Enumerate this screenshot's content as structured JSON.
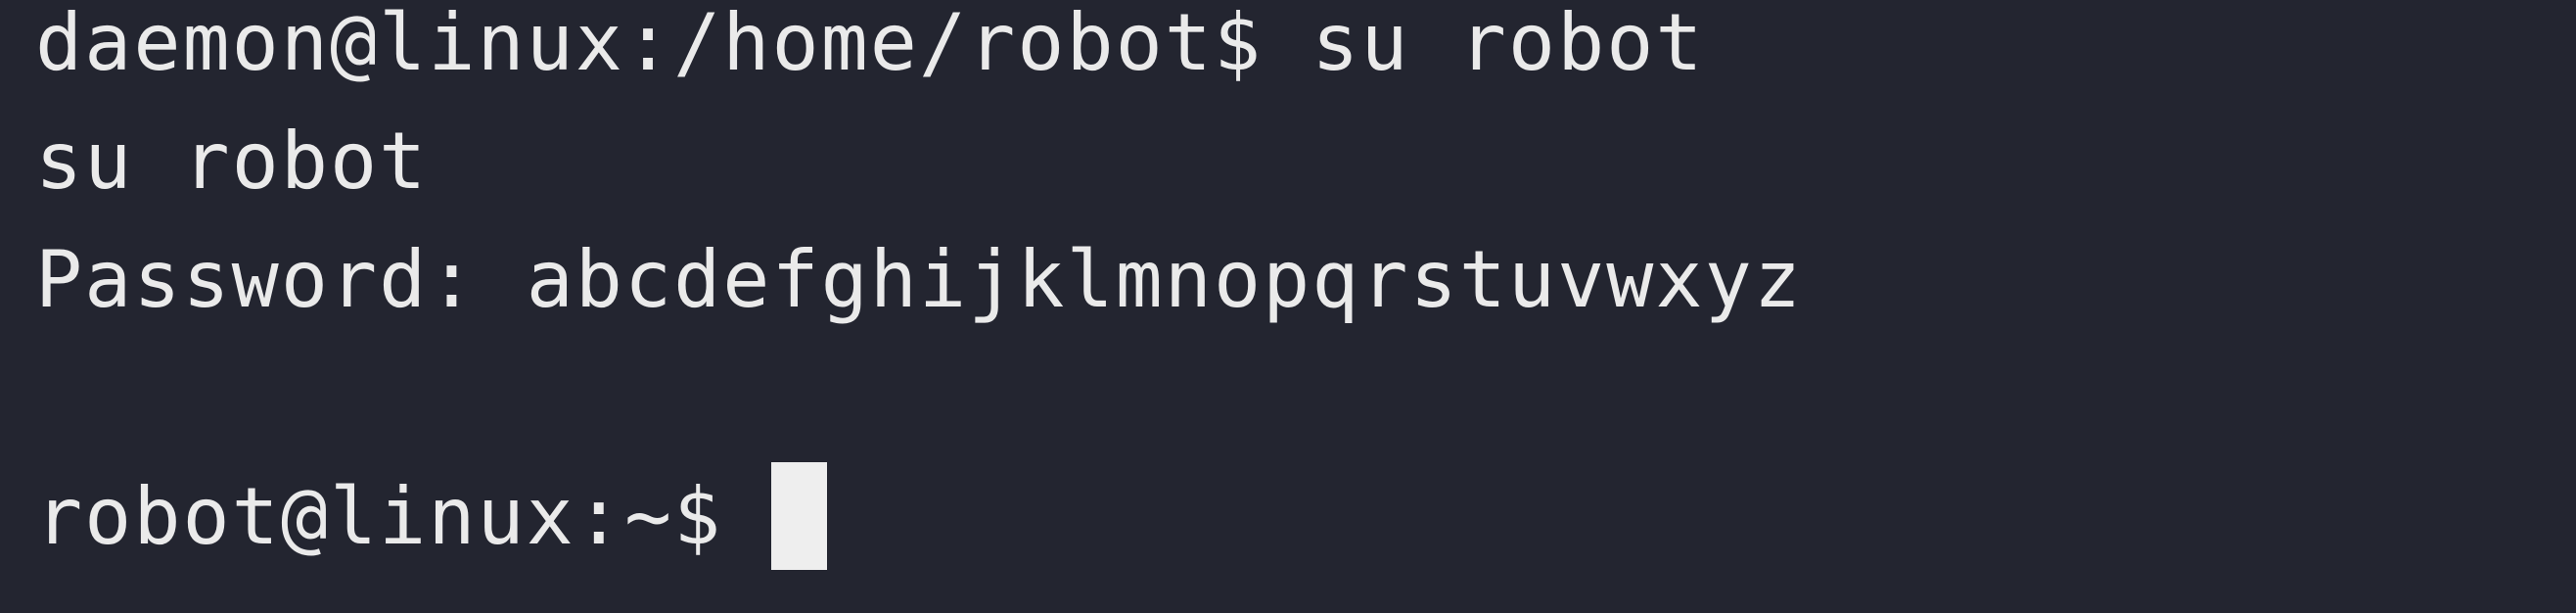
{
  "terminal": {
    "lines": [
      "daemon@linux:/home/robot$ su robot",
      "su robot",
      "Password: abcdefghijklmnopqrstuvwxyz",
      "",
      "robot@linux:~$ "
    ],
    "colors": {
      "background": "#232530",
      "foreground": "#eaeaea",
      "cursor": "#eeeeee"
    }
  }
}
